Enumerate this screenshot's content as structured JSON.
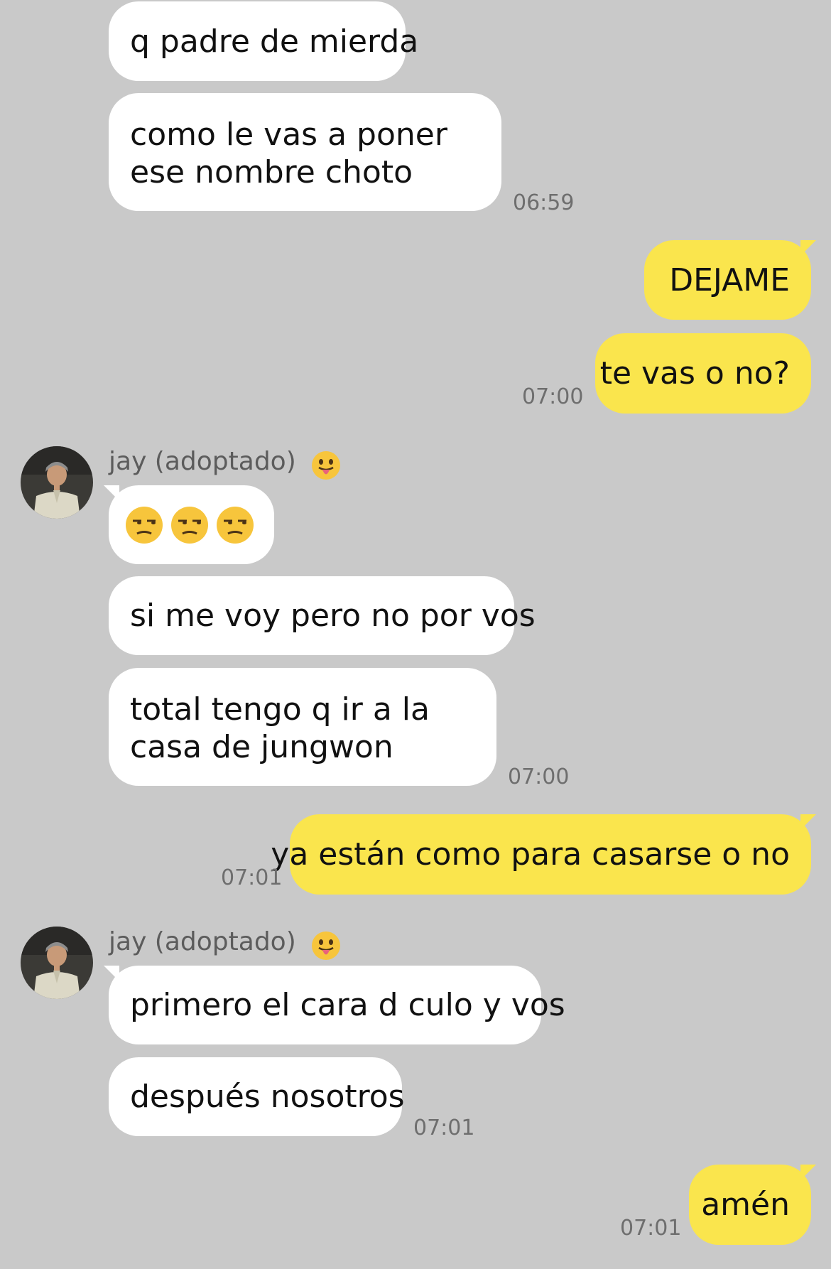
{
  "contact": {
    "name": "jay (adoptado)",
    "name_emoji": "tongue-out-emoji"
  },
  "messages": [
    {
      "side": "in",
      "text": "q padre de mierda"
    },
    {
      "side": "in",
      "text": "como le vas a poner ese nombre choto",
      "time": "06:59"
    },
    {
      "side": "out",
      "text": "DEJAME"
    },
    {
      "side": "out",
      "text": "te vas o no?",
      "time": "07:00"
    },
    {
      "side": "in",
      "text": "😒😒😒",
      "emoji_names": [
        "unamused-face-emoji",
        "unamused-face-emoji",
        "unamused-face-emoji"
      ]
    },
    {
      "side": "in",
      "text": "si me voy pero no por vos"
    },
    {
      "side": "in",
      "text": "total tengo q ir a la casa de jungwon",
      "time": "07:00"
    },
    {
      "side": "out",
      "text": "ya están como para casarse o no",
      "time": "07:01"
    },
    {
      "side": "in",
      "text": "primero el cara d culo y vos"
    },
    {
      "side": "in",
      "text": "después nosotros",
      "time": "07:01"
    },
    {
      "side": "out",
      "text": "amén",
      "time": "07:01"
    }
  ],
  "colors": {
    "background": "#c9c9c9",
    "incoming_bubble": "#ffffff",
    "outgoing_bubble": "#fae54d",
    "timestamp": "#6e6e6e"
  }
}
